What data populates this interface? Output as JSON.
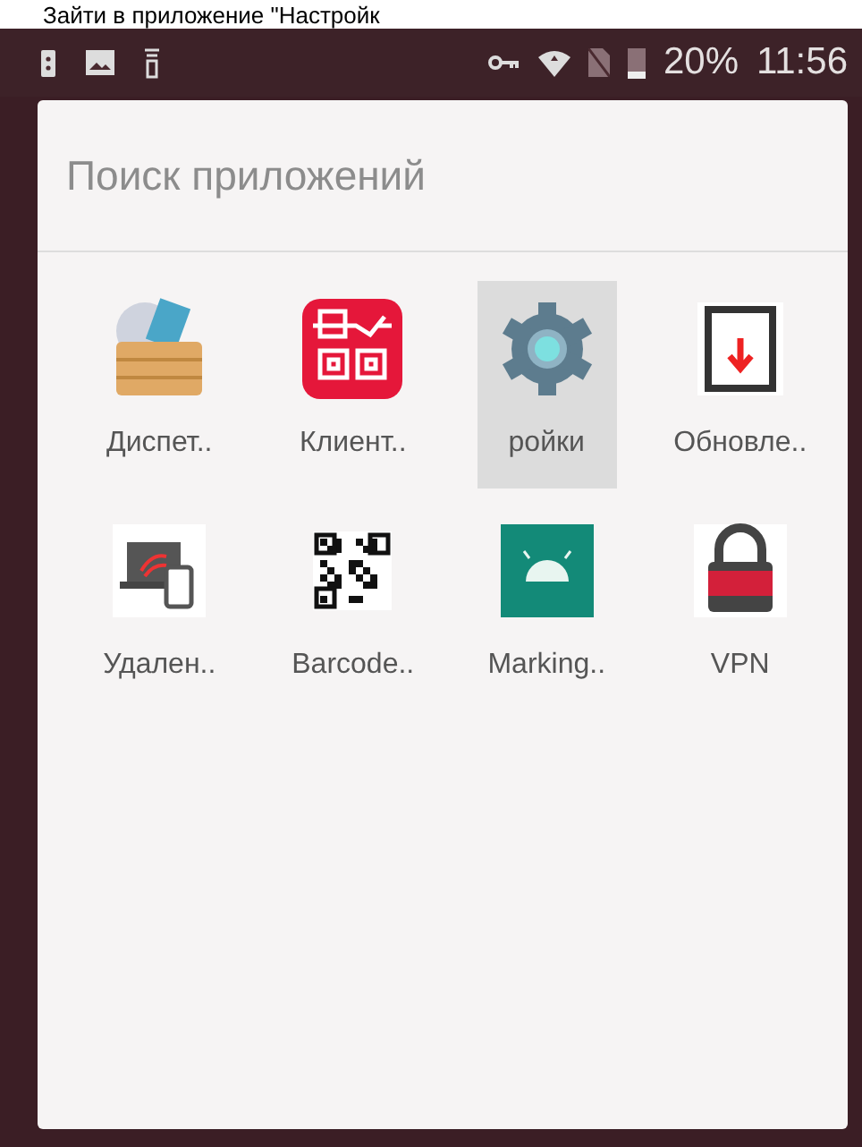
{
  "caption": "Зайти в приложение \"Настройк",
  "status_bar": {
    "battery_percent": "20%",
    "time": "11:56"
  },
  "search": {
    "placeholder": "Поиск приложений"
  },
  "apps": [
    {
      "label": "Диспет..",
      "kind": "box",
      "selected": false
    },
    {
      "label": "Клиент..",
      "kind": "client",
      "selected": false
    },
    {
      "label": "ройки",
      "kind": "gear",
      "selected": true
    },
    {
      "label": "Обновле..",
      "kind": "update",
      "selected": false
    },
    {
      "label": "Удален..",
      "kind": "remote",
      "selected": false
    },
    {
      "label": "Barcode..",
      "kind": "qr",
      "selected": false
    },
    {
      "label": "Marking..",
      "kind": "android",
      "selected": false
    },
    {
      "label": "VPN",
      "kind": "vpn",
      "selected": false
    }
  ]
}
